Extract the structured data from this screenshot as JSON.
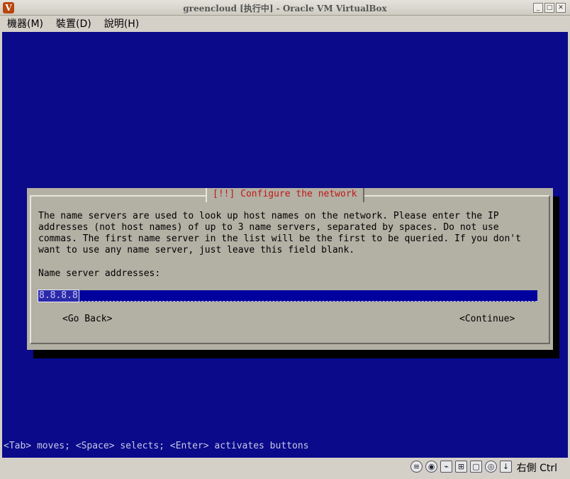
{
  "window": {
    "title": "greencloud [执行中] - Oracle VM VirtualBox",
    "app_icon": "virtualbox-icon",
    "buttons": [
      "minimize",
      "maximize",
      "close"
    ]
  },
  "menubar": {
    "items": [
      {
        "label": "機器(M)"
      },
      {
        "label": "裝置(D)"
      },
      {
        "label": "說明(H)"
      }
    ]
  },
  "dialog": {
    "title": "[!!] Configure the network",
    "description": "The name servers are used to look up host names on the network. Please enter the IP\naddresses (not host names) of up to 3 name servers, separated by spaces. Do not use\ncommas. The first name server in the list will be the first to be queried. If you don't\nwant to use any name server, just leave this field blank.",
    "field_label": "Name server addresses:",
    "field_value": "8.8.8.8",
    "back_label": "<Go Back>",
    "continue_label": "<Continue>"
  },
  "help_line": "<Tab> moves; <Space> selects; <Enter> activates buttons",
  "statusbar": {
    "icons": [
      "hdd-icon",
      "cd-icon",
      "usb-icon",
      "network-icon",
      "shared-folder-icon",
      "mouse-integration-icon",
      "capture-icon"
    ],
    "host_key": "右側 Ctrl"
  },
  "colors": {
    "screen_bg": "#0a0a8a",
    "dialog_bg": "#b3b0a4",
    "dialog_title": "#c01818"
  }
}
